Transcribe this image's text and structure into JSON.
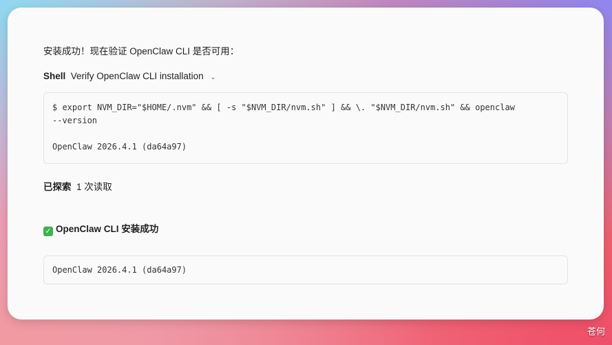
{
  "message": {
    "intro": "安装成功！现在验证 OpenClaw CLI 是否可用：",
    "tool": {
      "kind": "Shell",
      "title": "Verify OpenClaw CLI installation"
    },
    "command": {
      "line1": "$ export NVM_DIR=\"$HOME/.nvm\" && [ -s \"$NVM_DIR/nvm.sh\" ] && \\. \"$NVM_DIR/nvm.sh\" && openclaw",
      "line2": "--version",
      "output": "OpenClaw 2026.4.1 (da64a97)"
    },
    "explored": {
      "label": "已探索",
      "detail": "1 次读取"
    },
    "result_heading": "OpenClaw CLI 安装成功",
    "result_code": "OpenClaw 2026.4.1 (da64a97)"
  },
  "watermark": "苍何"
}
